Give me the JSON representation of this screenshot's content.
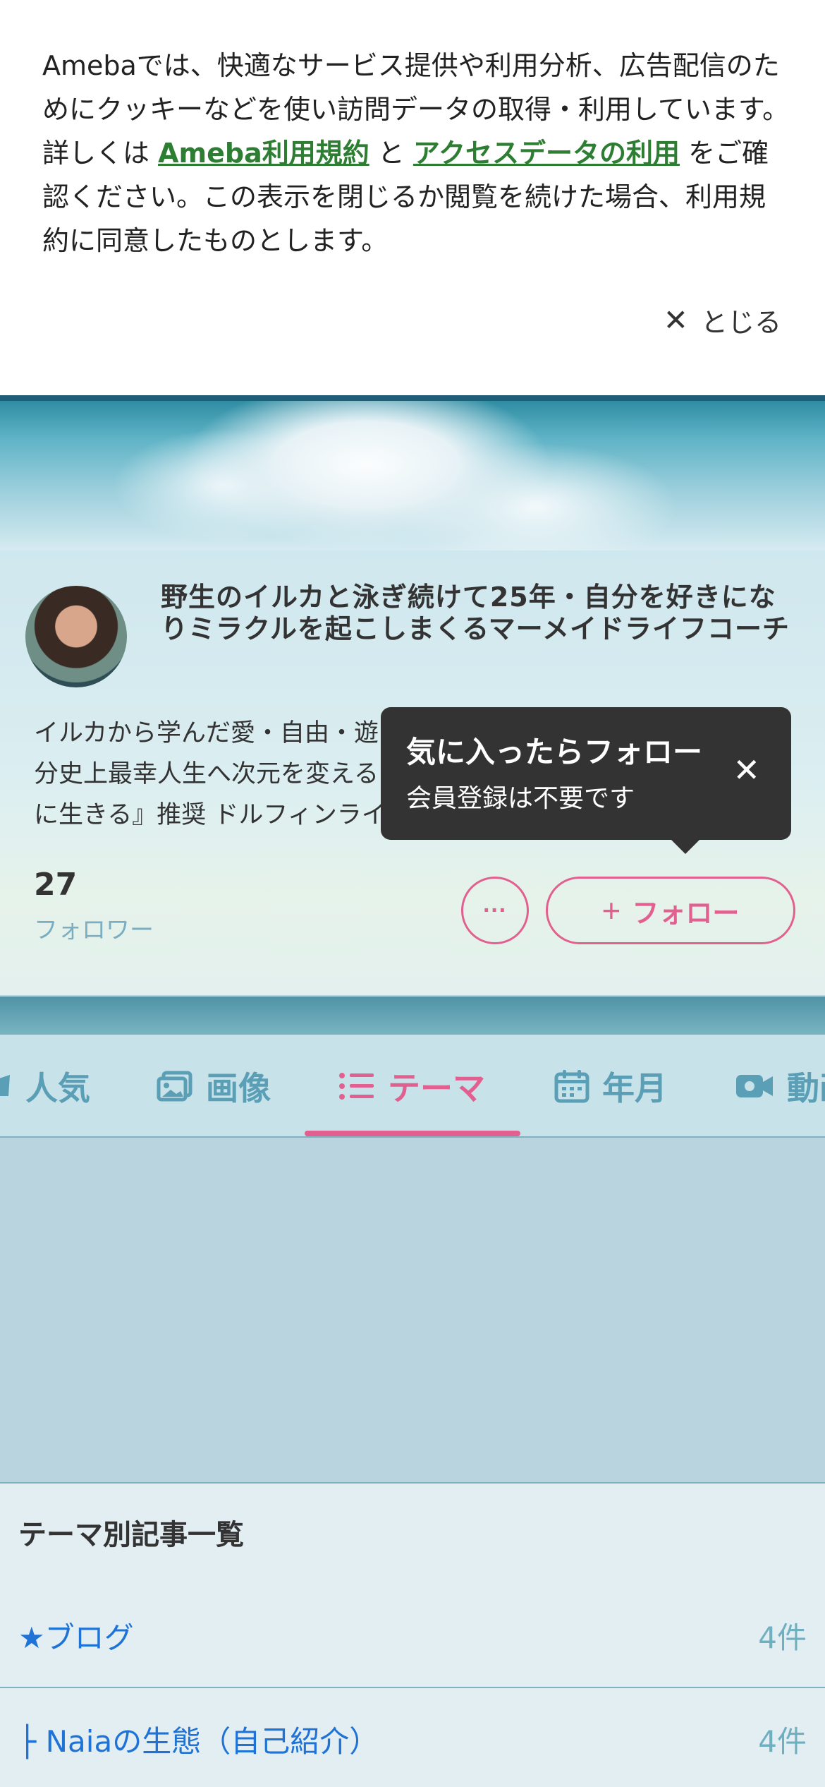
{
  "cookie": {
    "text_before": "Amebaでは、快適なサービス提供や利用分析、広告配信のためにクッキーなどを使い訪問データの取得・利用しています。詳しくは ",
    "link1": "Ameba利用規約",
    "text_mid": " と ",
    "link2": "アクセスデータの利用",
    "text_after": " をご確認ください。この表示を閉じるか閲覧を続けた場合、利用規約に同意したものとします。",
    "close_label": "とじる",
    "close_icon": "close-icon",
    "link_color": "#2d7d32"
  },
  "profile": {
    "title": "野生のイルカと泳ぎ続けて25年・自分を好きになりミラクルを起こしまくるマーメイドライフコーチ",
    "description_visible": "イルカから学んだ愛・自由・遊\n分史上最幸人生へ次元を変える\nに生きる』推奨 ドルフィンライ",
    "followers_count": "27",
    "followers_label": "フォロワー",
    "more_label": "···",
    "follow_label": "フォロー",
    "accent": "#e2608f"
  },
  "tooltip": {
    "title": "気に入ったらフォロー",
    "subtitle": "会員登録は不要です"
  },
  "tabs": [
    {
      "label": "人気",
      "icon": "crown-icon",
      "active": false
    },
    {
      "label": "画像",
      "icon": "image-icon",
      "active": false
    },
    {
      "label": "テーマ",
      "icon": "list-icon",
      "active": true
    },
    {
      "label": "年月",
      "icon": "calendar-icon",
      "active": false
    },
    {
      "label": "動画",
      "icon": "video-icon",
      "active": false
    }
  ],
  "themes": {
    "heading": "テーマ別記事一覧",
    "items": [
      {
        "name": "★ブログ",
        "count": "4件"
      },
      {
        "name": "├ Naiaの生態（自己紹介）",
        "count": "4件"
      }
    ]
  }
}
